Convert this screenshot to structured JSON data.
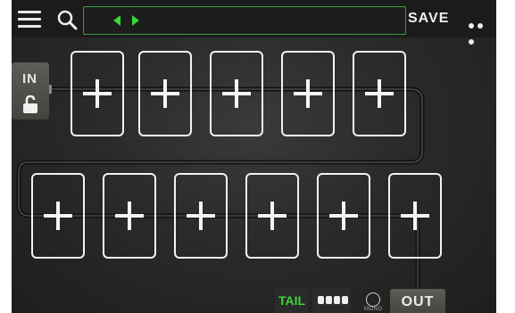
{
  "topbar": {
    "save_label": "SAVE"
  },
  "signal": {
    "input_label": "IN",
    "output_label": "OUT",
    "tail_label": "TAIL",
    "mono_label": "MONO"
  },
  "slots": {
    "row1_count": 5,
    "row2_count": 6
  },
  "colors": {
    "accent": "#37d837",
    "background": "#2a2a2a",
    "slot_border": "#f2f2f2"
  },
  "icons": [
    "menu-icon",
    "search-icon",
    "arrow-left-icon",
    "arrow-right-icon",
    "more-icon",
    "lock-icon",
    "plus-icon"
  ]
}
